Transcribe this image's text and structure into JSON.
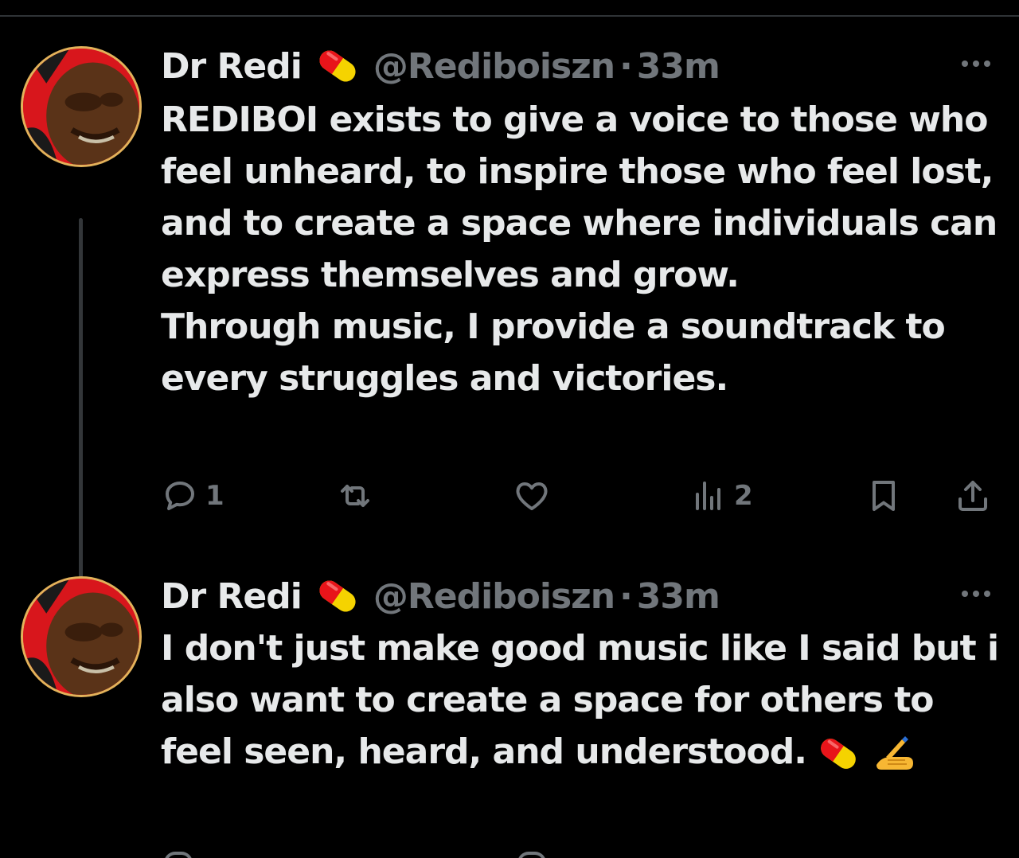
{
  "tweets": [
    {
      "author_name": "Dr Redi",
      "author_badge_icon": "pill-emoji-icon",
      "handle": "@Rediboiszn",
      "separator": "·",
      "time": "33m",
      "text": "REDIBOI exists to give a voice to those who feel unheard, to inspire those who feel lost, and to create a space where individuals can express themselves and grow.\nThrough music, I provide a soundtrack to every struggles and victories.",
      "actions": {
        "replies": "1",
        "reposts": "",
        "likes": "",
        "views": "2"
      }
    },
    {
      "author_name": "Dr Redi",
      "author_badge_icon": "pill-emoji-icon",
      "handle": "@Rediboiszn",
      "separator": "·",
      "time": "33m",
      "text": "I don't just make good music like I said but i also want to create a space for others to feel seen, heard, and understood.",
      "trailing_emojis": [
        "pill-emoji-icon",
        "writing-hand-emoji-icon"
      ]
    }
  ],
  "colors": {
    "background": "#000000",
    "primary_text": "#e7e9ea",
    "secondary_text": "#71767b",
    "divider": "#2f3336",
    "avatar_ring": "#e2b25a"
  }
}
